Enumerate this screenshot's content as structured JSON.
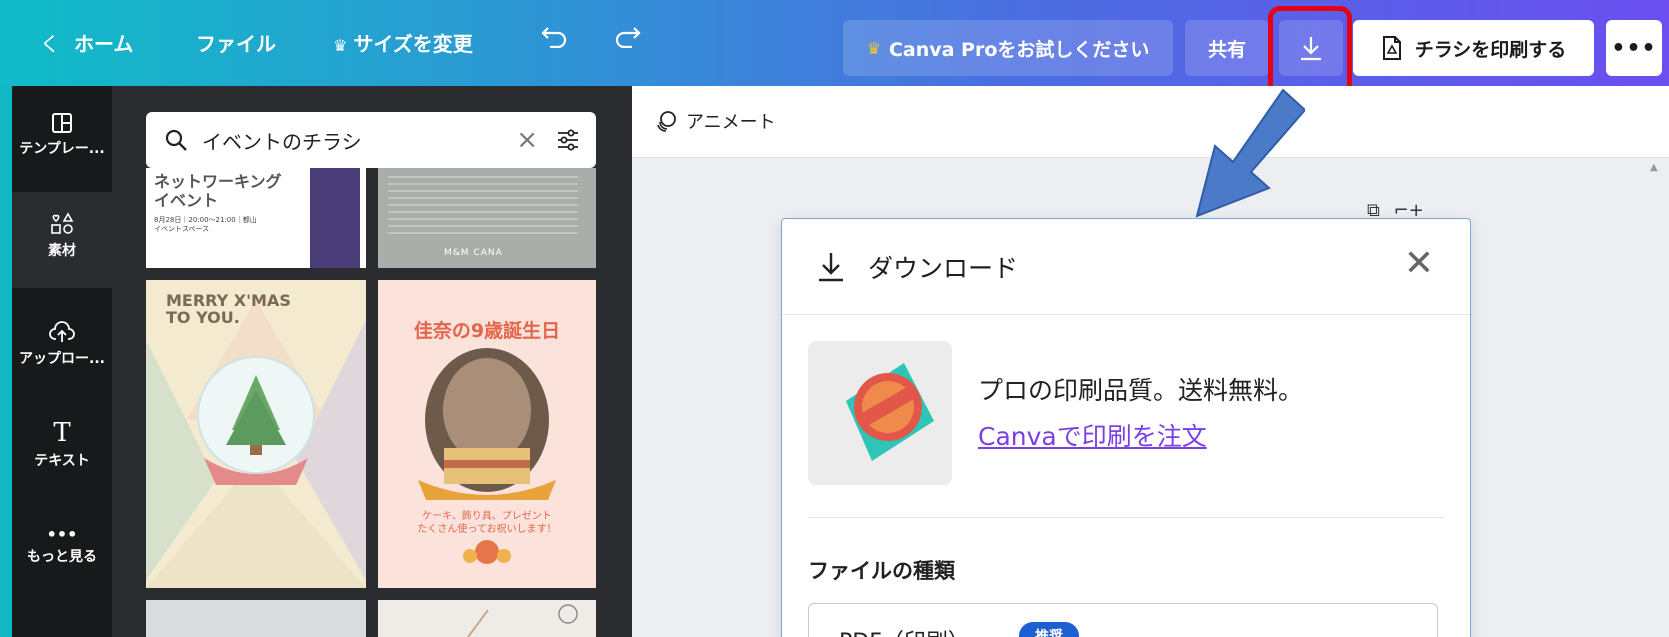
{
  "topbar": {
    "home": "ホーム",
    "back_chevron": "く",
    "file": "ファイル",
    "resize": "サイズを変更",
    "try_pro": "Canva Proをお試しください",
    "share": "共有",
    "print_flyer": "チラシを印刷する",
    "more": "•••",
    "highlight_color": "#e60012"
  },
  "sidebar": {
    "items": [
      {
        "label": "テンプレー...",
        "icon": "template-icon"
      },
      {
        "label": "素材",
        "icon": "elements-icon"
      },
      {
        "label": "アップロー...",
        "icon": "upload-icon"
      },
      {
        "label": "テキスト",
        "icon": "text-icon"
      },
      {
        "label": "もっと見る",
        "icon": "more-icon"
      }
    ]
  },
  "search": {
    "value": "イベントのチラシ"
  },
  "templates": {
    "t1_title": "ネットワーキング\nイベント",
    "t1_sub": "8月28日｜20:00〜21:00｜都山\nイベントスペース",
    "t2_brand": "M&M CANA",
    "t3_head": "MERRY X'MAS\nTO YOU.",
    "t4_head": "佳奈の9歳誕生日",
    "t4_cap": "ケーキ、飾り具、プレゼント\nたくさん使ってお祝いします！"
  },
  "canvas": {
    "animate": "アニメート"
  },
  "download_panel": {
    "title": "ダウンロード",
    "promo_text": "プロの印刷品質。送料無料。",
    "promo_link": "Canvaで印刷を注文",
    "file_type_label": "ファイルの種類",
    "file_type_value": "PDF（印刷）",
    "file_type_badge": "推奨",
    "link_color": "#7b3fe4"
  }
}
